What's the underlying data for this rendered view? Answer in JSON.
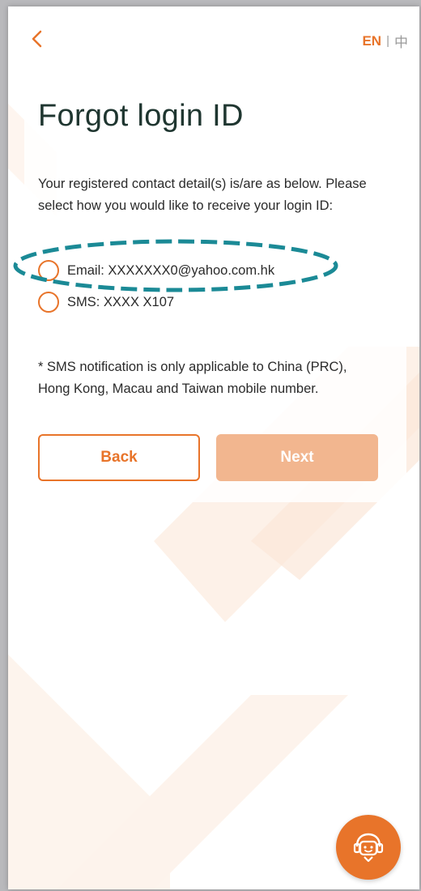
{
  "header": {
    "lang_en": "EN",
    "lang_sep": "|",
    "lang_zh": "中"
  },
  "page": {
    "title": "Forgot login ID",
    "description": "Your registered contact detail(s) is/are as below. Please select how you would like to receive your login ID:"
  },
  "options": {
    "email_label": "Email: XXXXXXX0@yahoo.com.hk",
    "sms_label": "SMS: XXXX X107"
  },
  "note": "* SMS notification is only applicable to China (PRC), Hong Kong, Macau and Taiwan mobile number.",
  "buttons": {
    "back": "Back",
    "next": "Next"
  },
  "colors": {
    "accent": "#e8742a",
    "accent_disabled": "#f2b68f",
    "title": "#1f3630",
    "highlight": "#1b8a96"
  },
  "icons": {
    "back": "chevron-left-icon",
    "chat": "chat-support-icon"
  }
}
